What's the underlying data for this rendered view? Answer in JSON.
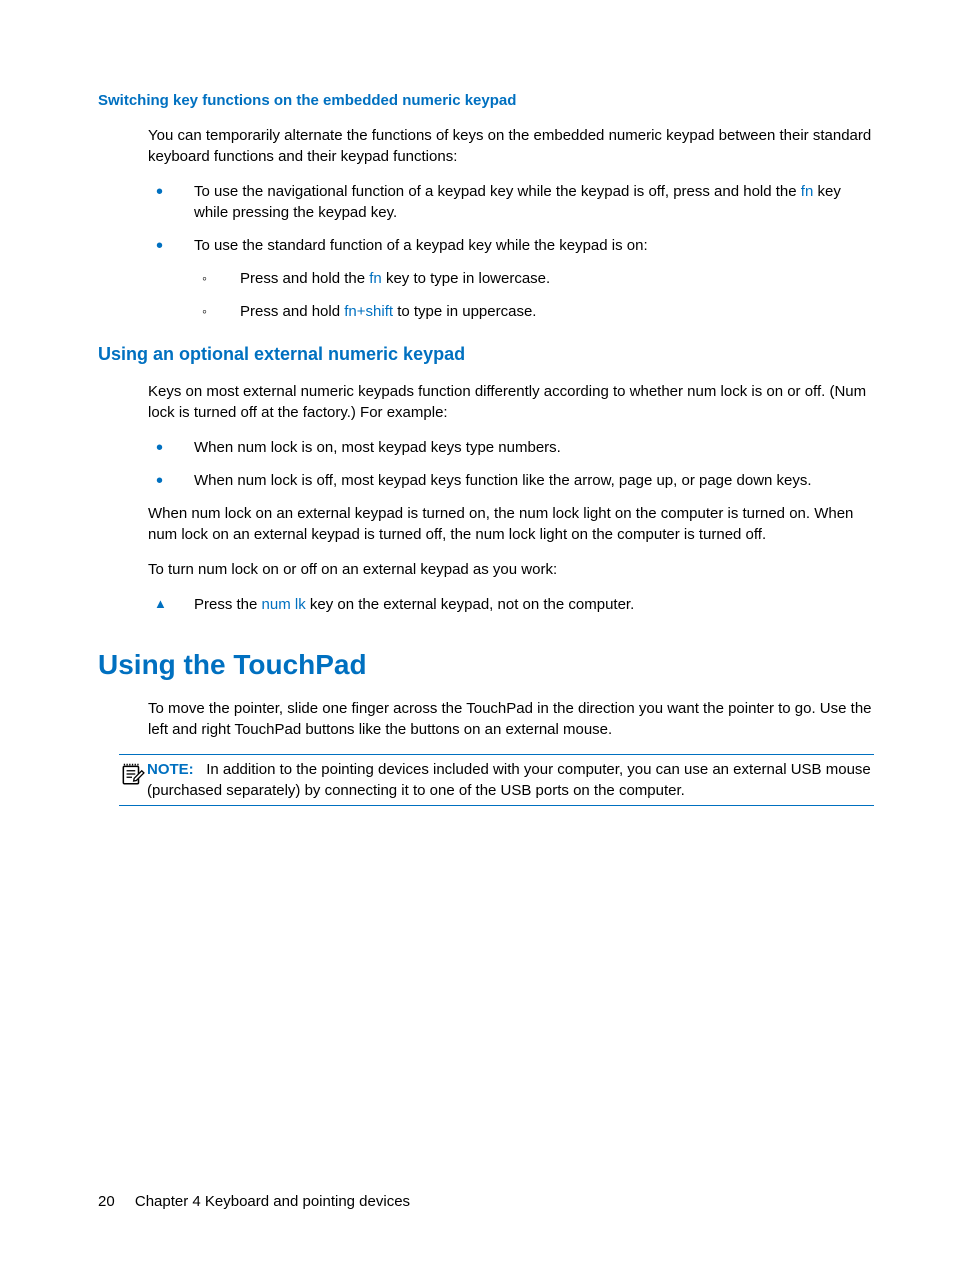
{
  "section1": {
    "heading": "Switching key functions on the embedded numeric keypad",
    "intro": "You can temporarily alternate the functions of keys on the embedded numeric keypad between their standard keyboard functions and their keypad functions:",
    "b1_pre": "To use the navigational function of a keypad key while the keypad is off, press and hold the ",
    "b1_key": "fn",
    "b1_post": " key while pressing the keypad key.",
    "b2": "To use the standard function of a keypad key while the keypad is on:",
    "s1_pre": "Press and hold the ",
    "s1_key": "fn",
    "s1_post": " key to type in lowercase.",
    "s2_pre": "Press and hold ",
    "s2_k1": "fn",
    "s2_plus": "+",
    "s2_k2": "shift",
    "s2_post": " to type in uppercase."
  },
  "section2": {
    "heading": "Using an optional external numeric keypad",
    "intro": "Keys on most external numeric keypads function differently according to whether num lock is on or off. (Num lock is turned off at the factory.) For example:",
    "b1": "When num lock is on, most keypad keys type numbers.",
    "b2": "When num lock is off, most keypad keys function like the arrow, page up, or page down keys.",
    "p2": "When num lock on an external keypad is turned on, the num lock light on the computer is turned on. When num lock on an external keypad is turned off, the num lock light on the computer is turned off.",
    "p3": "To turn num lock on or off on an external keypad as you work:",
    "t1_pre": "Press the ",
    "t1_key": "num lk",
    "t1_post": " key on the external keypad, not on the computer."
  },
  "section3": {
    "heading": "Using the TouchPad",
    "intro": "To move the pointer, slide one finger across the TouchPad in the direction you want the pointer to go. Use the left and right TouchPad buttons like the buttons on an external mouse.",
    "note_label": "NOTE:",
    "note_body": "In addition to the pointing devices included with your computer, you can use an external USB mouse (purchased separately) by connecting it to one of the USB ports on the computer."
  },
  "footer": {
    "page": "20",
    "chapter": "Chapter 4   Keyboard and pointing devices"
  }
}
